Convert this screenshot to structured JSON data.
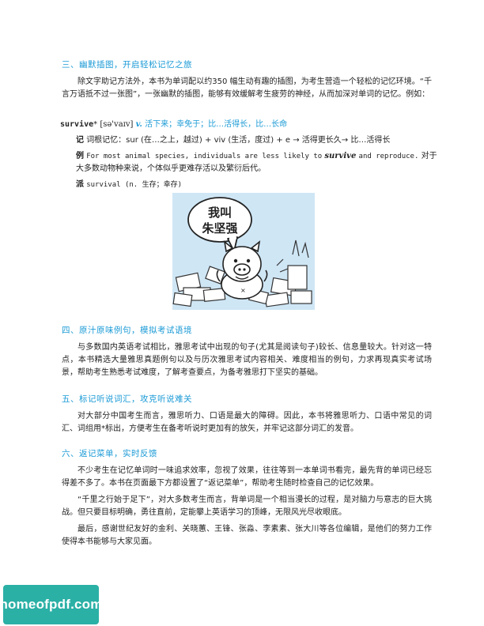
{
  "section3": {
    "heading": "三、幽默插图，开启轻松记忆之旅",
    "para": "除文字助记方法外，本书为单词配以约350 幅生动有趣的插图，为考生营造一个轻松的记忆环境。“千言万语抵不过一张图”，一张幽默的插图，能够有效缓解考生疲劳的神经，从而加深对单词的记忆。例如："
  },
  "entry": {
    "word": "survive",
    "mark": "*",
    "phonetic": "[sə'vaɪv]",
    "pos": "v.",
    "definition": "活下来；幸免于；比…活得长，比…长命",
    "memo_label": "记",
    "memo_text": "词根记忆：sur (在…之上，越过) + viv (生活，度过) + e → 活得更长久→ 比…活得长",
    "example_label": "例",
    "example_en_before": "For most animal species, individuals are less likely to",
    "example_en_word": "survive",
    "example_en_after": "and reproduce.",
    "example_zh_1": "对于",
    "example_zh_2": "大多数动物种来说，个体似乎更难存活以及繁衍后代。",
    "derivative_label": "派",
    "derivative_text": "survival (n. 生存；幸存)"
  },
  "illustration": {
    "speech_line1": "我叫",
    "speech_line2": "朱坚强"
  },
  "section4": {
    "heading": "四、原汁原味例句，模拟考试语境",
    "para": "与多数国内英语考试相比，雅思考试中出现的句子(尤其是阅读句子)较长、信息量较大。针对这一特点，本书精选大量雅思真题例句以及与历次雅思考试内容相关、难度相当的例句，力求再现真实考试场景，帮助考生熟悉考试难度，了解考查要点，为备考雅思打下坚实的基础。"
  },
  "section5": {
    "heading": "五、标记听说词汇，攻克听说难关",
    "para": "对大部分中国考生而言，雅思听力、口语是最大的障碍。因此，本书将雅思听力、口语中常见的词汇、词组用*标出，方便考生在备考听说时更加有的放矢，并牢记这部分词汇的发音。"
  },
  "section6": {
    "heading": "六、返记菜单，实时反馈",
    "para1": "不少考生在记忆单词时一味追求效率，忽视了效果，往往等到一本单词书看完，最先背的单词已经忘得差不多了。本书在页面最下方都设置了“返记菜单”，帮助考生随时检查自己的记忆效果。",
    "para2": "“千里之行始于足下”，对大多数考生而言，背单词是一个相当漫长的过程，是对脑力与意志的巨大挑战。但只要目标明确，勇往直前，定能攀上英语学习的顶峰，无限风光尽收眼底。",
    "para3": "最后，感谢世纪友好的金利、关晓蕙、王锋、张淼、李素素、张大川等各位编辑，是他们的努力工作使得本书能够与大家见面。"
  },
  "watermark": {
    "text": "homeofpdf.com"
  },
  "colors": {
    "heading": "#1a9ad6",
    "watermark_bg": "#2bb0a6"
  }
}
